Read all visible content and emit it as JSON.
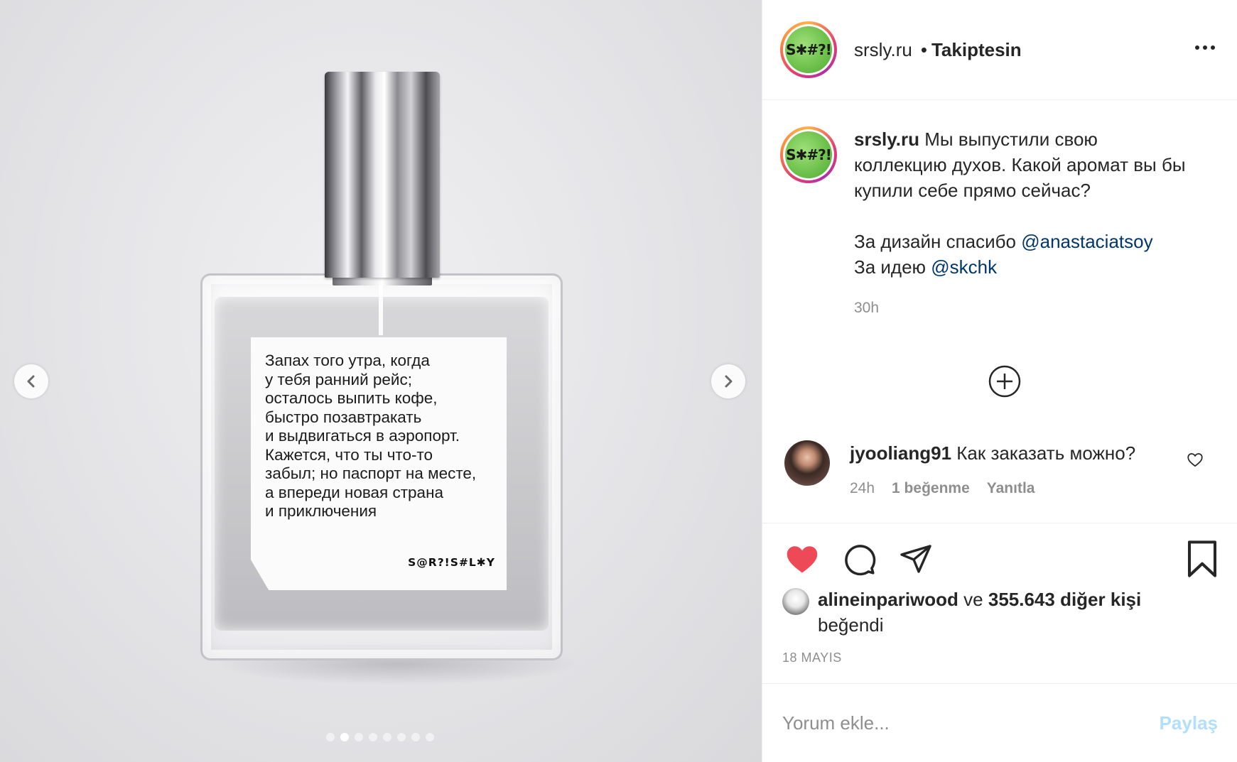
{
  "media": {
    "label_text": "Запах того утра, когда\nу тебя ранний рейс;\nосталось выпить кофе,\nбыстро позавтракать\nи выдвигаться в аэропорт.\nКажется, что ты что-то\nзабыл; но паспорт на месте,\nа впереди новая страна\nи приключения",
    "label_brand": "S@R?!S#L✱Y",
    "carousel": {
      "total": 8,
      "active_index": 1
    },
    "prev_icon": "chevron-left-icon",
    "next_icon": "chevron-right-icon"
  },
  "header": {
    "username": "srsly.ru",
    "separator": "•",
    "follow_status": "Takiptesin",
    "avatar_text": "S✱#?!",
    "more_icon": "ellipsis-icon"
  },
  "caption": {
    "username": "srsly.ru",
    "text": "Мы выпустили свою коллекцию духов. Какой аромат вы бы купили себе прямо сейчас?",
    "design_prefix": "За дизайн спасибо",
    "design_mention": "@anastaciatsoy",
    "idea_prefix": "За идею",
    "idea_mention": "@skchk",
    "time": "30h"
  },
  "load_more_icon": "plus-circle-icon",
  "comments": [
    {
      "username": "jyooliang91",
      "text": "Как заказать можно?",
      "time": "24h",
      "likes": "1 beğenme",
      "reply": "Yanıtla"
    }
  ],
  "actions": {
    "like_icon": "heart-filled-icon",
    "comment_icon": "comment-icon",
    "share_icon": "send-icon",
    "save_icon": "bookmark-icon"
  },
  "likes": {
    "user": "alineinpariwood",
    "connector": "ve",
    "others": "355.643 diğer kişi",
    "suffix": "beğendi"
  },
  "date": "18 MAYIS",
  "add_comment": {
    "placeholder": "Yorum ekle...",
    "post_label": "Paylaş"
  },
  "colors": {
    "like_red": "#ed4956",
    "mention_blue": "#00376b",
    "post_disabled": "#b2dffc",
    "secondary_text": "#8e8e8e"
  }
}
